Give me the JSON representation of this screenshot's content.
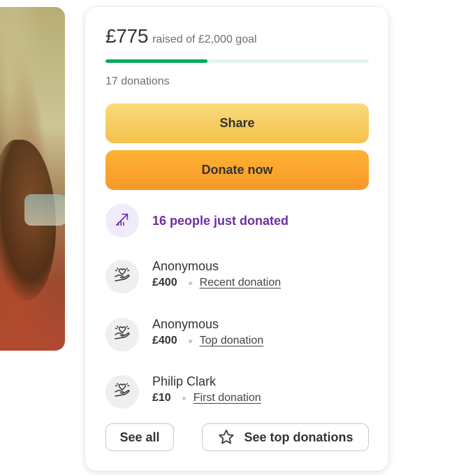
{
  "fundraiser": {
    "raised_amount": "£775",
    "goal_text": "raised of £2,000 goal",
    "progress_fraction": 0.3875,
    "donations_count": "17 donations"
  },
  "actions": {
    "share_label": "Share",
    "donate_label": "Donate now",
    "see_all_label": "See all",
    "see_top_label": "See top donations"
  },
  "trend": {
    "text": "16 people just donated",
    "icon": "trending-up-icon"
  },
  "donors": [
    {
      "name": "Anonymous",
      "amount": "£400",
      "tag": "Recent donation",
      "icon": "heart-hand-icon"
    },
    {
      "name": "Anonymous",
      "amount": "£400",
      "tag": "Top donation",
      "icon": "heart-hand-icon"
    },
    {
      "name": "Philip Clark",
      "amount": "£10",
      "tag": "First donation",
      "icon": "heart-hand-icon"
    }
  ],
  "colors": {
    "progress_fill": "#02a95c",
    "progress_track": "#e5f4ec",
    "share_button": "#f6c85c",
    "donate_button": "#fba72f",
    "trend_text": "#6b2fa0",
    "trend_bg": "#f0ebfa"
  }
}
